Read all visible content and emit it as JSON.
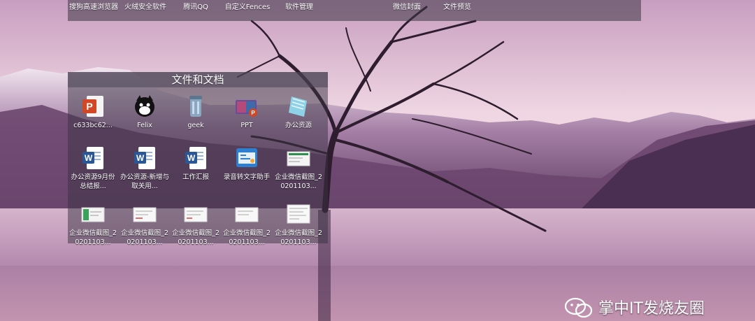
{
  "topbar": {
    "items": [
      {
        "label": "搜狗高速浏览器"
      },
      {
        "label": "火绒安全软件"
      },
      {
        "label": "腾讯QQ"
      },
      {
        "label": "自定义Fences"
      },
      {
        "label": "软件管理"
      },
      {
        "label": "微信封面"
      },
      {
        "label": "文件预览"
      }
    ]
  },
  "fence": {
    "title": "文件和文档",
    "items": [
      {
        "label": "c633bc62...",
        "icon": "powerpoint-icon"
      },
      {
        "label": "Felix",
        "icon": "cat-avatar-icon"
      },
      {
        "label": "geek",
        "icon": "geek-uninstaller-icon"
      },
      {
        "label": "PPT",
        "icon": "ppt-folder-icon"
      },
      {
        "label": "办公资源",
        "icon": "notebook-icon"
      },
      {
        "label": "办公资源9月份总结报...",
        "icon": "word-doc-icon"
      },
      {
        "label": "办公资源-新增与取关用...",
        "icon": "word-doc-icon"
      },
      {
        "label": "工作汇报",
        "icon": "word-doc-icon"
      },
      {
        "label": "录音转文字助手",
        "icon": "app-icon"
      },
      {
        "label": "企业微信截图_20201103...",
        "icon": "screenshot-file-icon"
      },
      {
        "label": "企业微信截图_20201103...",
        "icon": "screenshot-file-icon"
      },
      {
        "label": "企业微信截图_20201103...",
        "icon": "screenshot-file-icon"
      },
      {
        "label": "企业微信截图_20201103...",
        "icon": "screenshot-file-icon"
      },
      {
        "label": "企业微信截图_20201103...",
        "icon": "screenshot-file-icon"
      },
      {
        "label": "企业微信截图_20201103...",
        "icon": "screenshot-file-icon"
      }
    ]
  },
  "watermark": {
    "text": "掌中IT发烧友圈",
    "icon": "wechat-logo-icon"
  },
  "colors": {
    "fence_bg": "#37324199",
    "sky": "#f0d8e4",
    "water": "#c8a0c0"
  }
}
